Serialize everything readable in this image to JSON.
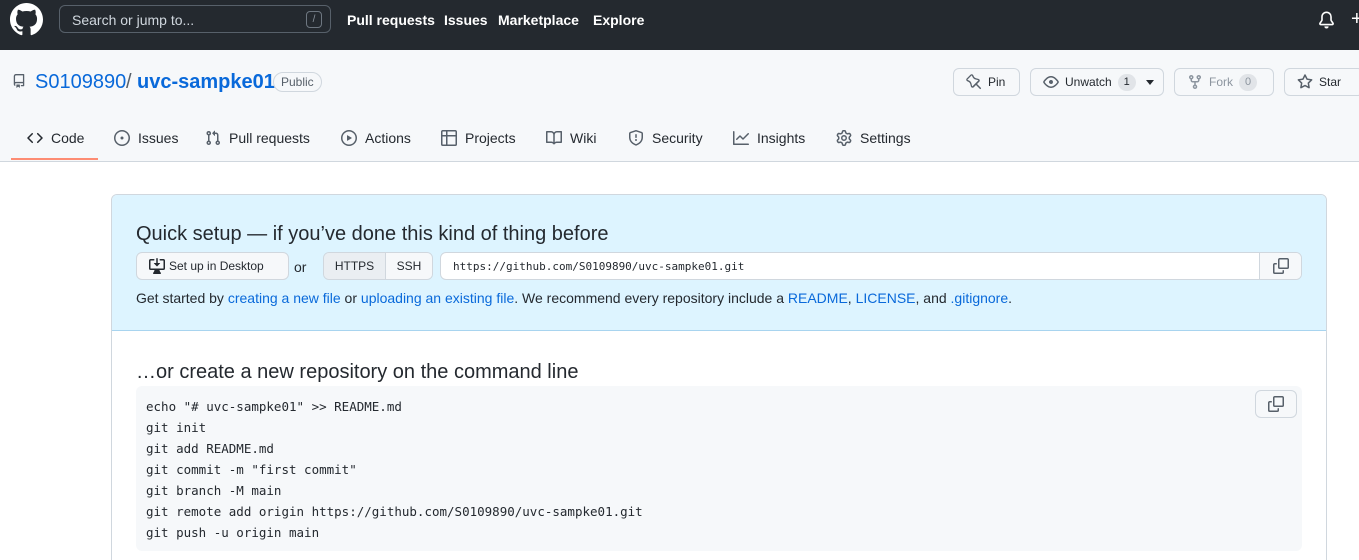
{
  "header": {
    "search_placeholder": "Search or jump to...",
    "search_shortcut": "/",
    "nav": [
      "Pull requests",
      "Issues",
      "Marketplace",
      "Explore"
    ],
    "plus_symbol": "+",
    "icons": [
      "github-logo-icon",
      "bell-icon",
      "plus-icon"
    ]
  },
  "repo": {
    "owner": "S0109890",
    "separator": "/",
    "name": "uvc-sampke01",
    "visibility": "Public",
    "pin_label": "Pin",
    "unwatch_label": "Unwatch",
    "watch_count": "1",
    "fork_label": "Fork",
    "fork_count": "0",
    "star_label": "Star"
  },
  "tabs": [
    {
      "label": "Code",
      "icon": "code-icon",
      "selected": true
    },
    {
      "label": "Issues",
      "icon": "issue-opened-icon"
    },
    {
      "label": "Pull requests",
      "icon": "git-pull-request-icon"
    },
    {
      "label": "Actions",
      "icon": "play-icon"
    },
    {
      "label": "Projects",
      "icon": "table-icon"
    },
    {
      "label": "Wiki",
      "icon": "book-icon"
    },
    {
      "label": "Security",
      "icon": "shield-icon"
    },
    {
      "label": "Insights",
      "icon": "graph-icon"
    },
    {
      "label": "Settings",
      "icon": "gear-icon"
    }
  ],
  "quick_setup": {
    "title": "Quick setup — if you’ve done this kind of thing before",
    "desktop_button": "Set up in Desktop",
    "or": "or",
    "https": "HTTPS",
    "ssh": "SSH",
    "url": "https://github.com/S0109890/uvc-sampke01.git",
    "line": {
      "t1": "Get started by ",
      "l1": "creating a new file",
      "t2": " or ",
      "l2": "uploading an existing file",
      "t3": ". We recommend every repository include a ",
      "l3": "README",
      "t4": ", ",
      "l4": "LICENSE",
      "t5": ", and ",
      "l5": ".gitignore",
      "t6": "."
    }
  },
  "command_line": {
    "title": "…or create a new repository on the command line",
    "lines": [
      "echo \"# uvc-sampke01\" >> README.md",
      "git init",
      "git add README.md",
      "git commit -m \"first commit\"",
      "git branch -M main",
      "git remote add origin https://github.com/S0109890/uvc-sampke01.git",
      "git push -u origin main"
    ]
  },
  "colors": {
    "header_bg": "#24292f",
    "link": "#0969da",
    "quick_setup_bg": "#ddf4ff",
    "selected_tab_underline": "#fd8c73"
  }
}
